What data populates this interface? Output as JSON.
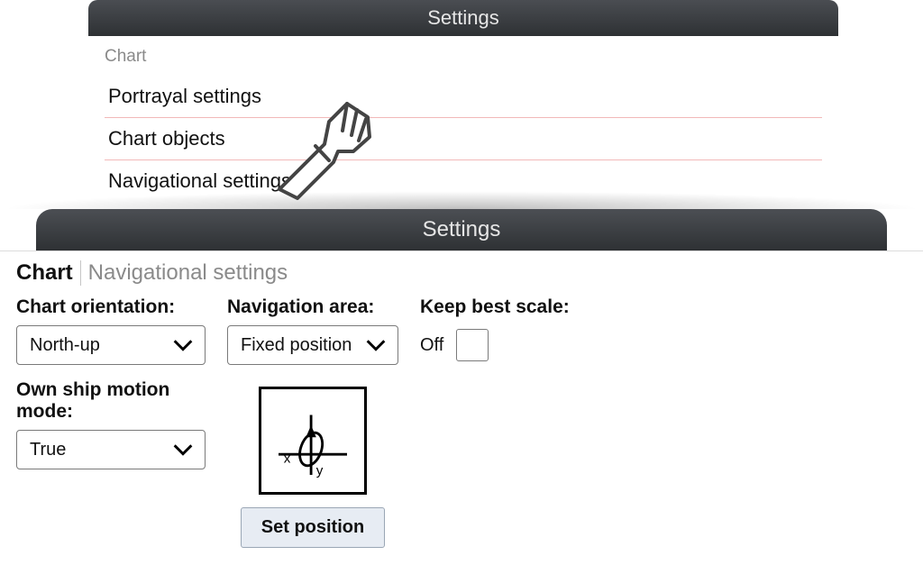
{
  "top": {
    "title": "Settings",
    "section": "Chart",
    "items": [
      {
        "label": "Portrayal settings"
      },
      {
        "label": "Chart objects"
      },
      {
        "label": "Navigational settings"
      }
    ]
  },
  "bottom": {
    "title": "Settings",
    "breadcrumb": {
      "first": "Chart",
      "second": "Navigational settings"
    },
    "fields": {
      "chart_orientation_label": "Chart orientation:",
      "chart_orientation_value": "North-up",
      "own_ship_mode_label": "Own ship motion mode:",
      "own_ship_mode_value": "True",
      "navigation_area_label": "Navigation area:",
      "navigation_area_value": "Fixed position",
      "keep_best_scale_label": "Keep best scale:",
      "keep_best_scale_value": "Off",
      "set_position_button": "Set position",
      "diagram_x": "x",
      "diagram_y": "y"
    }
  }
}
